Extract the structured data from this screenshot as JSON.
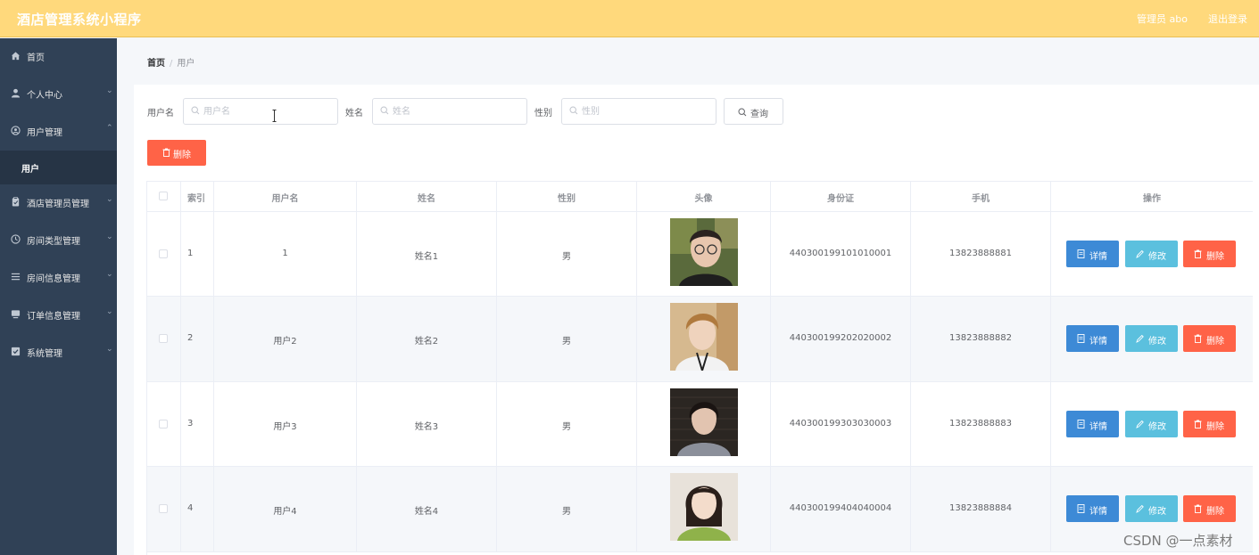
{
  "app": {
    "title": "酒店管理系统小程序"
  },
  "header": {
    "user": "管理员 abo",
    "logout": "退出登录"
  },
  "sidebar": {
    "items": [
      {
        "label": "首页",
        "icon": "home-icon",
        "chevron": ""
      },
      {
        "label": "个人中心",
        "icon": "person-icon",
        "chevron": "⌄"
      },
      {
        "label": "用户管理",
        "icon": "user-circle-icon",
        "chevron": "⌃"
      },
      {
        "label": "酒店管理员管理",
        "icon": "clipboard-icon",
        "chevron": "⌄"
      },
      {
        "label": "房间类型管理",
        "icon": "clock-icon",
        "chevron": "⌄"
      },
      {
        "label": "房间信息管理",
        "icon": "list-icon",
        "chevron": "⌄"
      },
      {
        "label": "订单信息管理",
        "icon": "monitor-icon",
        "chevron": "⌄"
      },
      {
        "label": "系统管理",
        "icon": "check-square-icon",
        "chevron": "⌄"
      }
    ],
    "active_sub": "用户"
  },
  "breadcrumb": {
    "home": "首页",
    "sep": "/",
    "current": "用户"
  },
  "search": {
    "username_label": "用户名",
    "username_placeholder": "用户名",
    "username_value": "",
    "name_label": "姓名",
    "name_placeholder": "姓名",
    "gender_label": "性别",
    "gender_placeholder": "性别",
    "query_button": "查询"
  },
  "delete_button": "删除",
  "table": {
    "columns": [
      "",
      "索引",
      "用户名",
      "姓名",
      "性别",
      "头像",
      "身份证",
      "手机",
      "操作"
    ],
    "rows": [
      {
        "index": "1",
        "username": "1",
        "name": "姓名1",
        "gender": "男",
        "id_card": "440300199101010001",
        "phone": "13823888881"
      },
      {
        "index": "2",
        "username": "用户2",
        "name": "姓名2",
        "gender": "男",
        "id_card": "440300199202020002",
        "phone": "13823888882"
      },
      {
        "index": "3",
        "username": "用户3",
        "name": "姓名3",
        "gender": "男",
        "id_card": "440300199303030003",
        "phone": "13823888883"
      },
      {
        "index": "4",
        "username": "用户4",
        "name": "姓名4",
        "gender": "男",
        "id_card": "440300199404040004",
        "phone": "13823888884"
      }
    ],
    "actions": {
      "detail": "详情",
      "edit": "修改",
      "delete": "删除"
    }
  },
  "watermark": "CSDN @一点素材",
  "colors": {
    "header": "#ffd97c",
    "sidebar": "#304156",
    "danger": "#ff6347",
    "primary": "#3d8ad6",
    "info": "#5bc0de"
  }
}
